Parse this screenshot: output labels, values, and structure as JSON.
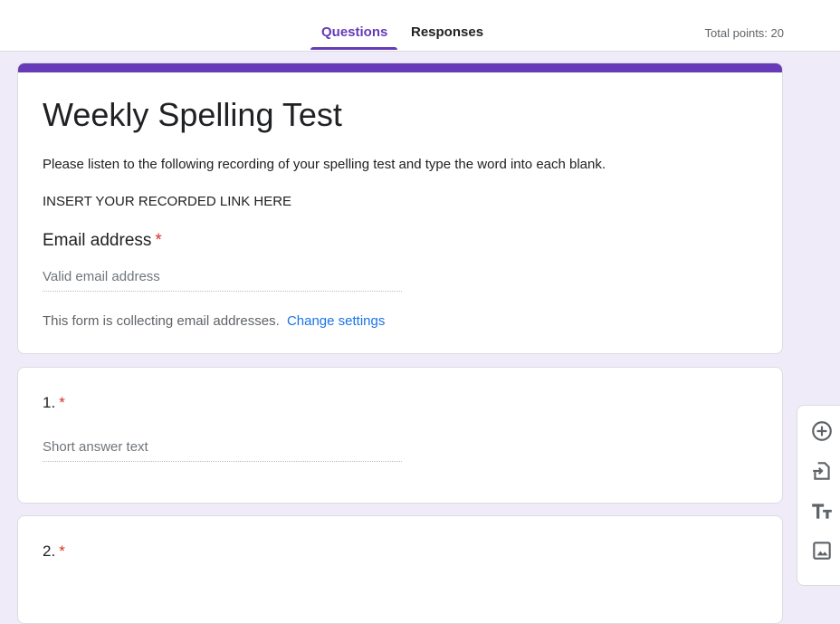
{
  "tabs": [
    {
      "label": "Questions",
      "active": true
    },
    {
      "label": "Responses",
      "active": false
    }
  ],
  "total_points": "Total points: 20",
  "header": {
    "title": "Weekly Spelling Test",
    "description": "Please listen to the following recording of your spelling test and type the word into each blank.",
    "link_text": "INSERT YOUR RECORDED LINK HERE"
  },
  "email": {
    "label": "Email address",
    "required_mark": "*",
    "placeholder": "Valid email address",
    "note": "This form is collecting email addresses.",
    "settings_link": "Change settings"
  },
  "questions": [
    {
      "label": "1.",
      "required_mark": "*",
      "placeholder": "Short answer text"
    },
    {
      "label": "2.",
      "required_mark": "*"
    }
  ],
  "toolbar": [
    "add-question-icon",
    "import-questions-icon",
    "add-title-icon",
    "add-image-icon"
  ],
  "colors": {
    "accent": "#673ab7",
    "background": "#f0ebf8",
    "link": "#1a73e8",
    "required": "#d93025"
  }
}
